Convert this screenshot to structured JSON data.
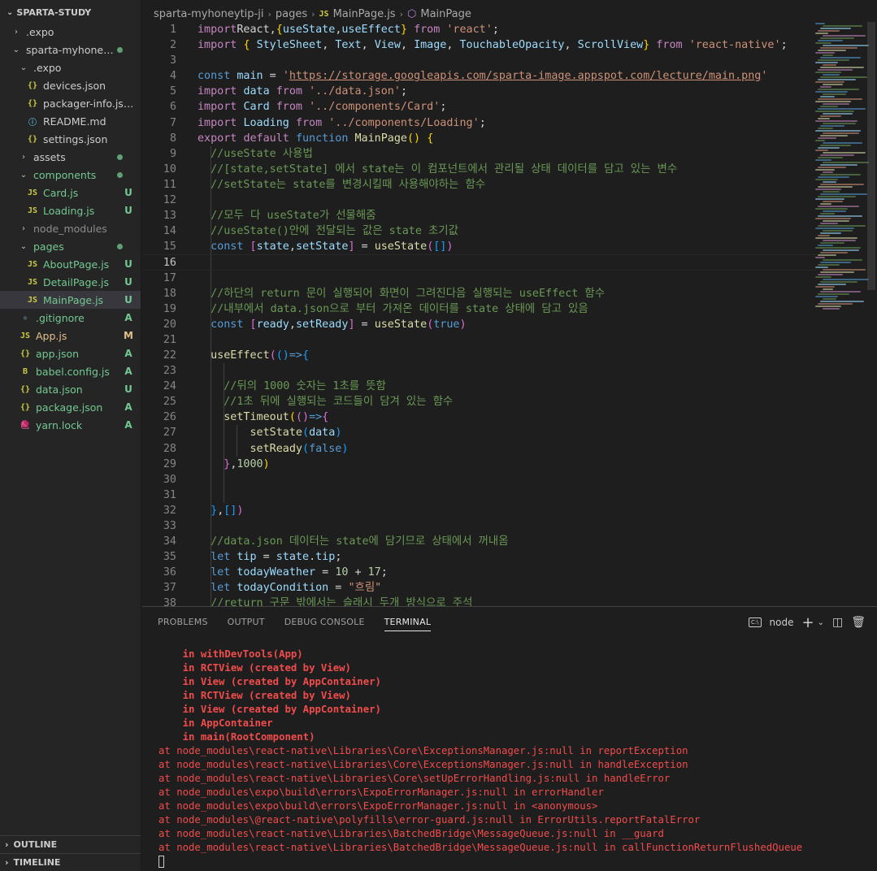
{
  "explorer": {
    "title": "SPARTA-STUDY",
    "items": [
      {
        "label": ".expo",
        "kind": "folder",
        "open": false,
        "depth": 0,
        "badge": "",
        "dot": false,
        "color": "",
        "icon": ""
      },
      {
        "label": "sparta-myhoney...",
        "kind": "folder",
        "open": true,
        "depth": 0,
        "badge": "",
        "dot": true,
        "color": "",
        "icon": ""
      },
      {
        "label": ".expo",
        "kind": "folder",
        "open": true,
        "depth": 1,
        "badge": "",
        "dot": false,
        "color": "",
        "icon": ""
      },
      {
        "label": "devices.json",
        "kind": "file",
        "depth": 2,
        "badge": "",
        "dot": false,
        "color": "",
        "icon": "{}"
      },
      {
        "label": "packager-info.json",
        "kind": "file",
        "depth": 2,
        "badge": "",
        "dot": false,
        "color": "",
        "icon": "{}"
      },
      {
        "label": "README.md",
        "kind": "file",
        "depth": 2,
        "badge": "",
        "dot": false,
        "color": "",
        "icon": "ⓘ"
      },
      {
        "label": "settings.json",
        "kind": "file",
        "depth": 2,
        "badge": "",
        "dot": false,
        "color": "",
        "icon": "{}"
      },
      {
        "label": "assets",
        "kind": "folder",
        "open": false,
        "depth": 1,
        "badge": "",
        "dot": true,
        "color": "",
        "icon": ""
      },
      {
        "label": "components",
        "kind": "folder",
        "open": true,
        "depth": 1,
        "badge": "",
        "dot": true,
        "color": "green",
        "icon": ""
      },
      {
        "label": "Card.js",
        "kind": "file",
        "depth": 2,
        "badge": "U",
        "dot": false,
        "color": "green",
        "icon": "JS"
      },
      {
        "label": "Loading.js",
        "kind": "file",
        "depth": 2,
        "badge": "U",
        "dot": false,
        "color": "green",
        "icon": "JS"
      },
      {
        "label": "node_modules",
        "kind": "folder",
        "open": false,
        "depth": 1,
        "badge": "",
        "dot": false,
        "color": "gray",
        "icon": ""
      },
      {
        "label": "pages",
        "kind": "folder",
        "open": true,
        "depth": 1,
        "badge": "",
        "dot": true,
        "color": "green",
        "icon": ""
      },
      {
        "label": "AboutPage.js",
        "kind": "file",
        "depth": 2,
        "badge": "U",
        "dot": false,
        "color": "green",
        "icon": "JS"
      },
      {
        "label": "DetailPage.js",
        "kind": "file",
        "depth": 2,
        "badge": "U",
        "dot": false,
        "color": "green",
        "icon": "JS"
      },
      {
        "label": "MainPage.js",
        "kind": "file",
        "depth": 2,
        "badge": "U",
        "dot": false,
        "color": "green",
        "icon": "JS",
        "selected": true
      },
      {
        "label": ".gitignore",
        "kind": "file",
        "depth": 1,
        "badge": "A",
        "dot": false,
        "color": "green",
        "icon": "◆"
      },
      {
        "label": "App.js",
        "kind": "file",
        "depth": 1,
        "badge": "M",
        "dot": false,
        "color": "orange",
        "icon": "JS"
      },
      {
        "label": "app.json",
        "kind": "file",
        "depth": 1,
        "badge": "A",
        "dot": false,
        "color": "green",
        "icon": "{}"
      },
      {
        "label": "babel.config.js",
        "kind": "file",
        "depth": 1,
        "badge": "A",
        "dot": false,
        "color": "green",
        "icon": "B"
      },
      {
        "label": "data.json",
        "kind": "file",
        "depth": 1,
        "badge": "U",
        "dot": false,
        "color": "green",
        "icon": "{}"
      },
      {
        "label": "package.json",
        "kind": "file",
        "depth": 1,
        "badge": "A",
        "dot": false,
        "color": "green",
        "icon": "{}"
      },
      {
        "label": "yarn.lock",
        "kind": "file",
        "depth": 1,
        "badge": "A",
        "dot": false,
        "color": "green",
        "icon": "🧶"
      }
    ],
    "outline_label": "OUTLINE",
    "timeline_label": "TIMELINE"
  },
  "breadcrumb": {
    "folder": "sparta-myhoneytip-ji",
    "subfolder": "pages",
    "file": "MainPage.js",
    "file_icon": "JS",
    "symbol": "MainPage"
  },
  "code": {
    "active_line": 16,
    "lines": [
      [
        [
          "kc",
          "import"
        ],
        [
          "",
          "React,"
        ],
        [
          "br1",
          "{"
        ],
        [
          "vr",
          "useState"
        ],
        [
          "",
          ","
        ],
        [
          "vr",
          "useEffect"
        ],
        [
          "br1",
          "}"
        ],
        [
          "",
          " "
        ],
        [
          "kc",
          "from"
        ],
        [
          "",
          " "
        ],
        [
          "st",
          "'react'"
        ],
        [
          "",
          ";"
        ]
      ],
      [
        [
          "kc",
          "import"
        ],
        [
          "",
          " "
        ],
        [
          "br1",
          "{"
        ],
        [
          "",
          " "
        ],
        [
          "vr",
          "StyleSheet"
        ],
        [
          "",
          ", "
        ],
        [
          "vr",
          "Text"
        ],
        [
          "",
          ", "
        ],
        [
          "vr",
          "View"
        ],
        [
          "",
          ", "
        ],
        [
          "vr",
          "Image"
        ],
        [
          "",
          ", "
        ],
        [
          "vr",
          "TouchableOpacity"
        ],
        [
          "",
          ", "
        ],
        [
          "vr",
          "ScrollView"
        ],
        [
          "br1",
          "}"
        ],
        [
          "",
          " "
        ],
        [
          "kc",
          "from"
        ],
        [
          "",
          " "
        ],
        [
          "st",
          "'react-native'"
        ],
        [
          "",
          ";"
        ]
      ],
      [],
      [
        [
          "kw",
          "const"
        ],
        [
          "",
          " "
        ],
        [
          "vr",
          "main"
        ],
        [
          "",
          " = "
        ],
        [
          "st",
          "'"
        ],
        [
          "sturl",
          "https://storage.googleapis.com/sparta-image.appspot.com/lecture/main.png"
        ],
        [
          "st",
          "'"
        ]
      ],
      [
        [
          "kc",
          "import"
        ],
        [
          "",
          " "
        ],
        [
          "vr",
          "data"
        ],
        [
          "",
          " "
        ],
        [
          "kc",
          "from"
        ],
        [
          "",
          " "
        ],
        [
          "st",
          "'../data.json'"
        ],
        [
          "",
          ";"
        ]
      ],
      [
        [
          "kc",
          "import"
        ],
        [
          "",
          " "
        ],
        [
          "vr",
          "Card"
        ],
        [
          "",
          " "
        ],
        [
          "kc",
          "from"
        ],
        [
          "",
          " "
        ],
        [
          "st",
          "'../components/Card'"
        ],
        [
          "",
          ";"
        ]
      ],
      [
        [
          "kc",
          "import"
        ],
        [
          "",
          " "
        ],
        [
          "vr",
          "Loading"
        ],
        [
          "",
          " "
        ],
        [
          "kc",
          "from"
        ],
        [
          "",
          " "
        ],
        [
          "st",
          "'../components/Loading'"
        ],
        [
          "",
          ";"
        ]
      ],
      [
        [
          "kc",
          "export"
        ],
        [
          "",
          " "
        ],
        [
          "kc",
          "default"
        ],
        [
          "",
          " "
        ],
        [
          "kw",
          "function"
        ],
        [
          "",
          " "
        ],
        [
          "fn",
          "MainPage"
        ],
        [
          "br1",
          "()"
        ],
        [
          "",
          " "
        ],
        [
          "br1",
          "{"
        ]
      ],
      [
        [
          "",
          "  "
        ],
        [
          "cm",
          "//useState 사용법"
        ]
      ],
      [
        [
          "",
          "  "
        ],
        [
          "cm",
          "//[state,setState] 에서 state는 이 컴포넌트에서 관리될 상태 데이터를 담고 있는 변수"
        ]
      ],
      [
        [
          "",
          "  "
        ],
        [
          "cm",
          "//setState는 state를 변경시킬때 사용해야하는 함수"
        ]
      ],
      [],
      [
        [
          "",
          "  "
        ],
        [
          "cm",
          "//모두 다 useState가 선물해줌"
        ]
      ],
      [
        [
          "",
          "  "
        ],
        [
          "cm",
          "//useState()안에 전달되는 값은 state 초기값"
        ]
      ],
      [
        [
          "",
          "  "
        ],
        [
          "kw",
          "const"
        ],
        [
          "",
          " "
        ],
        [
          "br2",
          "["
        ],
        [
          "vr",
          "state"
        ],
        [
          "",
          ","
        ],
        [
          "vr",
          "setState"
        ],
        [
          "br2",
          "]"
        ],
        [
          "",
          " = "
        ],
        [
          "fn",
          "useState"
        ],
        [
          "br2",
          "("
        ],
        [
          "br3",
          "[]"
        ],
        [
          "br2",
          ")"
        ]
      ],
      [],
      [],
      [
        [
          "",
          "  "
        ],
        [
          "cm",
          "//하단의 return 문이 실행되어 화면이 그려진다음 실행되는 useEffect 함수"
        ]
      ],
      [
        [
          "",
          "  "
        ],
        [
          "cm",
          "//내부에서 data.json으로 부터 가져온 데이터를 state 상태에 담고 있음"
        ]
      ],
      [
        [
          "",
          "  "
        ],
        [
          "kw",
          "const"
        ],
        [
          "",
          " "
        ],
        [
          "br2",
          "["
        ],
        [
          "vr",
          "ready"
        ],
        [
          "",
          ","
        ],
        [
          "vr",
          "setReady"
        ],
        [
          "br2",
          "]"
        ],
        [
          "",
          " = "
        ],
        [
          "fn",
          "useState"
        ],
        [
          "br2",
          "("
        ],
        [
          "kw",
          "true"
        ],
        [
          "br2",
          ")"
        ]
      ],
      [],
      [
        [
          "",
          "  "
        ],
        [
          "fn",
          "useEffect"
        ],
        [
          "br2",
          "("
        ],
        [
          "br3",
          "()"
        ],
        [
          "kw",
          "=>"
        ],
        [
          "br3",
          "{"
        ]
      ],
      [],
      [
        [
          "",
          "    "
        ],
        [
          "cm",
          "//뒤의 1000 숫자는 1초를 뜻함"
        ]
      ],
      [
        [
          "",
          "    "
        ],
        [
          "cm",
          "//1초 뒤에 실행되는 코드들이 담겨 있는 함수"
        ]
      ],
      [
        [
          "",
          "    "
        ],
        [
          "fn",
          "setTimeout"
        ],
        [
          "br1",
          "("
        ],
        [
          "br2",
          "()"
        ],
        [
          "kw",
          "=>"
        ],
        [
          "br2",
          "{"
        ]
      ],
      [
        [
          "",
          "        "
        ],
        [
          "fn",
          "setState"
        ],
        [
          "br3",
          "("
        ],
        [
          "vr",
          "data"
        ],
        [
          "br3",
          ")"
        ]
      ],
      [
        [
          "",
          "        "
        ],
        [
          "fn",
          "setReady"
        ],
        [
          "br3",
          "("
        ],
        [
          "kw",
          "false"
        ],
        [
          "br3",
          ")"
        ]
      ],
      [
        [
          "",
          "    "
        ],
        [
          "br2",
          "}"
        ],
        [
          "",
          ","
        ],
        [
          "nm",
          "1000"
        ],
        [
          "br1",
          ")"
        ]
      ],
      [],
      [],
      [
        [
          "",
          "  "
        ],
        [
          "br3",
          "}"
        ],
        [
          "",
          ","
        ],
        [
          "br3",
          "[]"
        ],
        [
          "br2",
          ")"
        ]
      ],
      [],
      [
        [
          "",
          "  "
        ],
        [
          "cm",
          "//data.json 데이터는 state에 담기므로 상태에서 꺼내옴"
        ]
      ],
      [
        [
          "",
          "  "
        ],
        [
          "kw",
          "let"
        ],
        [
          "",
          " "
        ],
        [
          "vr",
          "tip"
        ],
        [
          "",
          " = "
        ],
        [
          "vr",
          "state"
        ],
        [
          "",
          "."
        ],
        [
          "vr",
          "tip"
        ],
        [
          "",
          ";"
        ]
      ],
      [
        [
          "",
          "  "
        ],
        [
          "kw",
          "let"
        ],
        [
          "",
          " "
        ],
        [
          "vr",
          "todayWeather"
        ],
        [
          "",
          " = "
        ],
        [
          "nm",
          "10"
        ],
        [
          "",
          " + "
        ],
        [
          "nm",
          "17"
        ],
        [
          "",
          ";"
        ]
      ],
      [
        [
          "",
          "  "
        ],
        [
          "kw",
          "let"
        ],
        [
          "",
          " "
        ],
        [
          "vr",
          "todayCondition"
        ],
        [
          "",
          " = "
        ],
        [
          "st",
          "\"흐림\""
        ]
      ],
      [
        [
          "",
          "  "
        ],
        [
          "cm",
          "//return 구문 밖에서는 슬래시 두개 방식으로 주석"
        ]
      ]
    ]
  },
  "panel": {
    "tabs": [
      "PROBLEMS",
      "OUTPUT",
      "DEBUG CONSOLE",
      "TERMINAL"
    ],
    "active_tab": "TERMINAL",
    "shell_label": "node",
    "terminal_lines": [
      {
        "text": "    in withDevTools(App)",
        "bold": true
      },
      {
        "text": "    in RCTView (created by View)",
        "bold": true
      },
      {
        "text": "    in View (created by AppContainer)",
        "bold": true
      },
      {
        "text": "    in RCTView (created by View)",
        "bold": true
      },
      {
        "text": "    in View (created by AppContainer)",
        "bold": true
      },
      {
        "text": "    in AppContainer",
        "bold": true
      },
      {
        "text": "    in main(RootComponent)",
        "bold": true
      },
      {
        "text": "at node_modules\\react-native\\Libraries\\Core\\ExceptionsManager.js:null in reportException",
        "bold": false
      },
      {
        "text": "at node_modules\\react-native\\Libraries\\Core\\ExceptionsManager.js:null in handleException",
        "bold": false
      },
      {
        "text": "at node_modules\\react-native\\Libraries\\Core\\setUpErrorHandling.js:null in handleError",
        "bold": false
      },
      {
        "text": "at node_modules\\expo\\build\\errors\\ExpoErrorManager.js:null in errorHandler",
        "bold": false
      },
      {
        "text": "at node_modules\\expo\\build\\errors\\ExpoErrorManager.js:null in <anonymous>",
        "bold": false
      },
      {
        "text": "at node_modules\\@react-native\\polyfills\\error-guard.js:null in ErrorUtils.reportFatalError",
        "bold": false
      },
      {
        "text": "at node_modules\\react-native\\Libraries\\BatchedBridge\\MessageQueue.js:null in __guard",
        "bold": false
      },
      {
        "text": "at node_modules\\react-native\\Libraries\\BatchedBridge\\MessageQueue.js:null in callFunctionReturnFlushedQueue",
        "bold": false
      }
    ]
  },
  "colors": {
    "accent_green": "#73c991",
    "accent_orange": "#e2c08d",
    "error_red": "#f14c4c"
  }
}
